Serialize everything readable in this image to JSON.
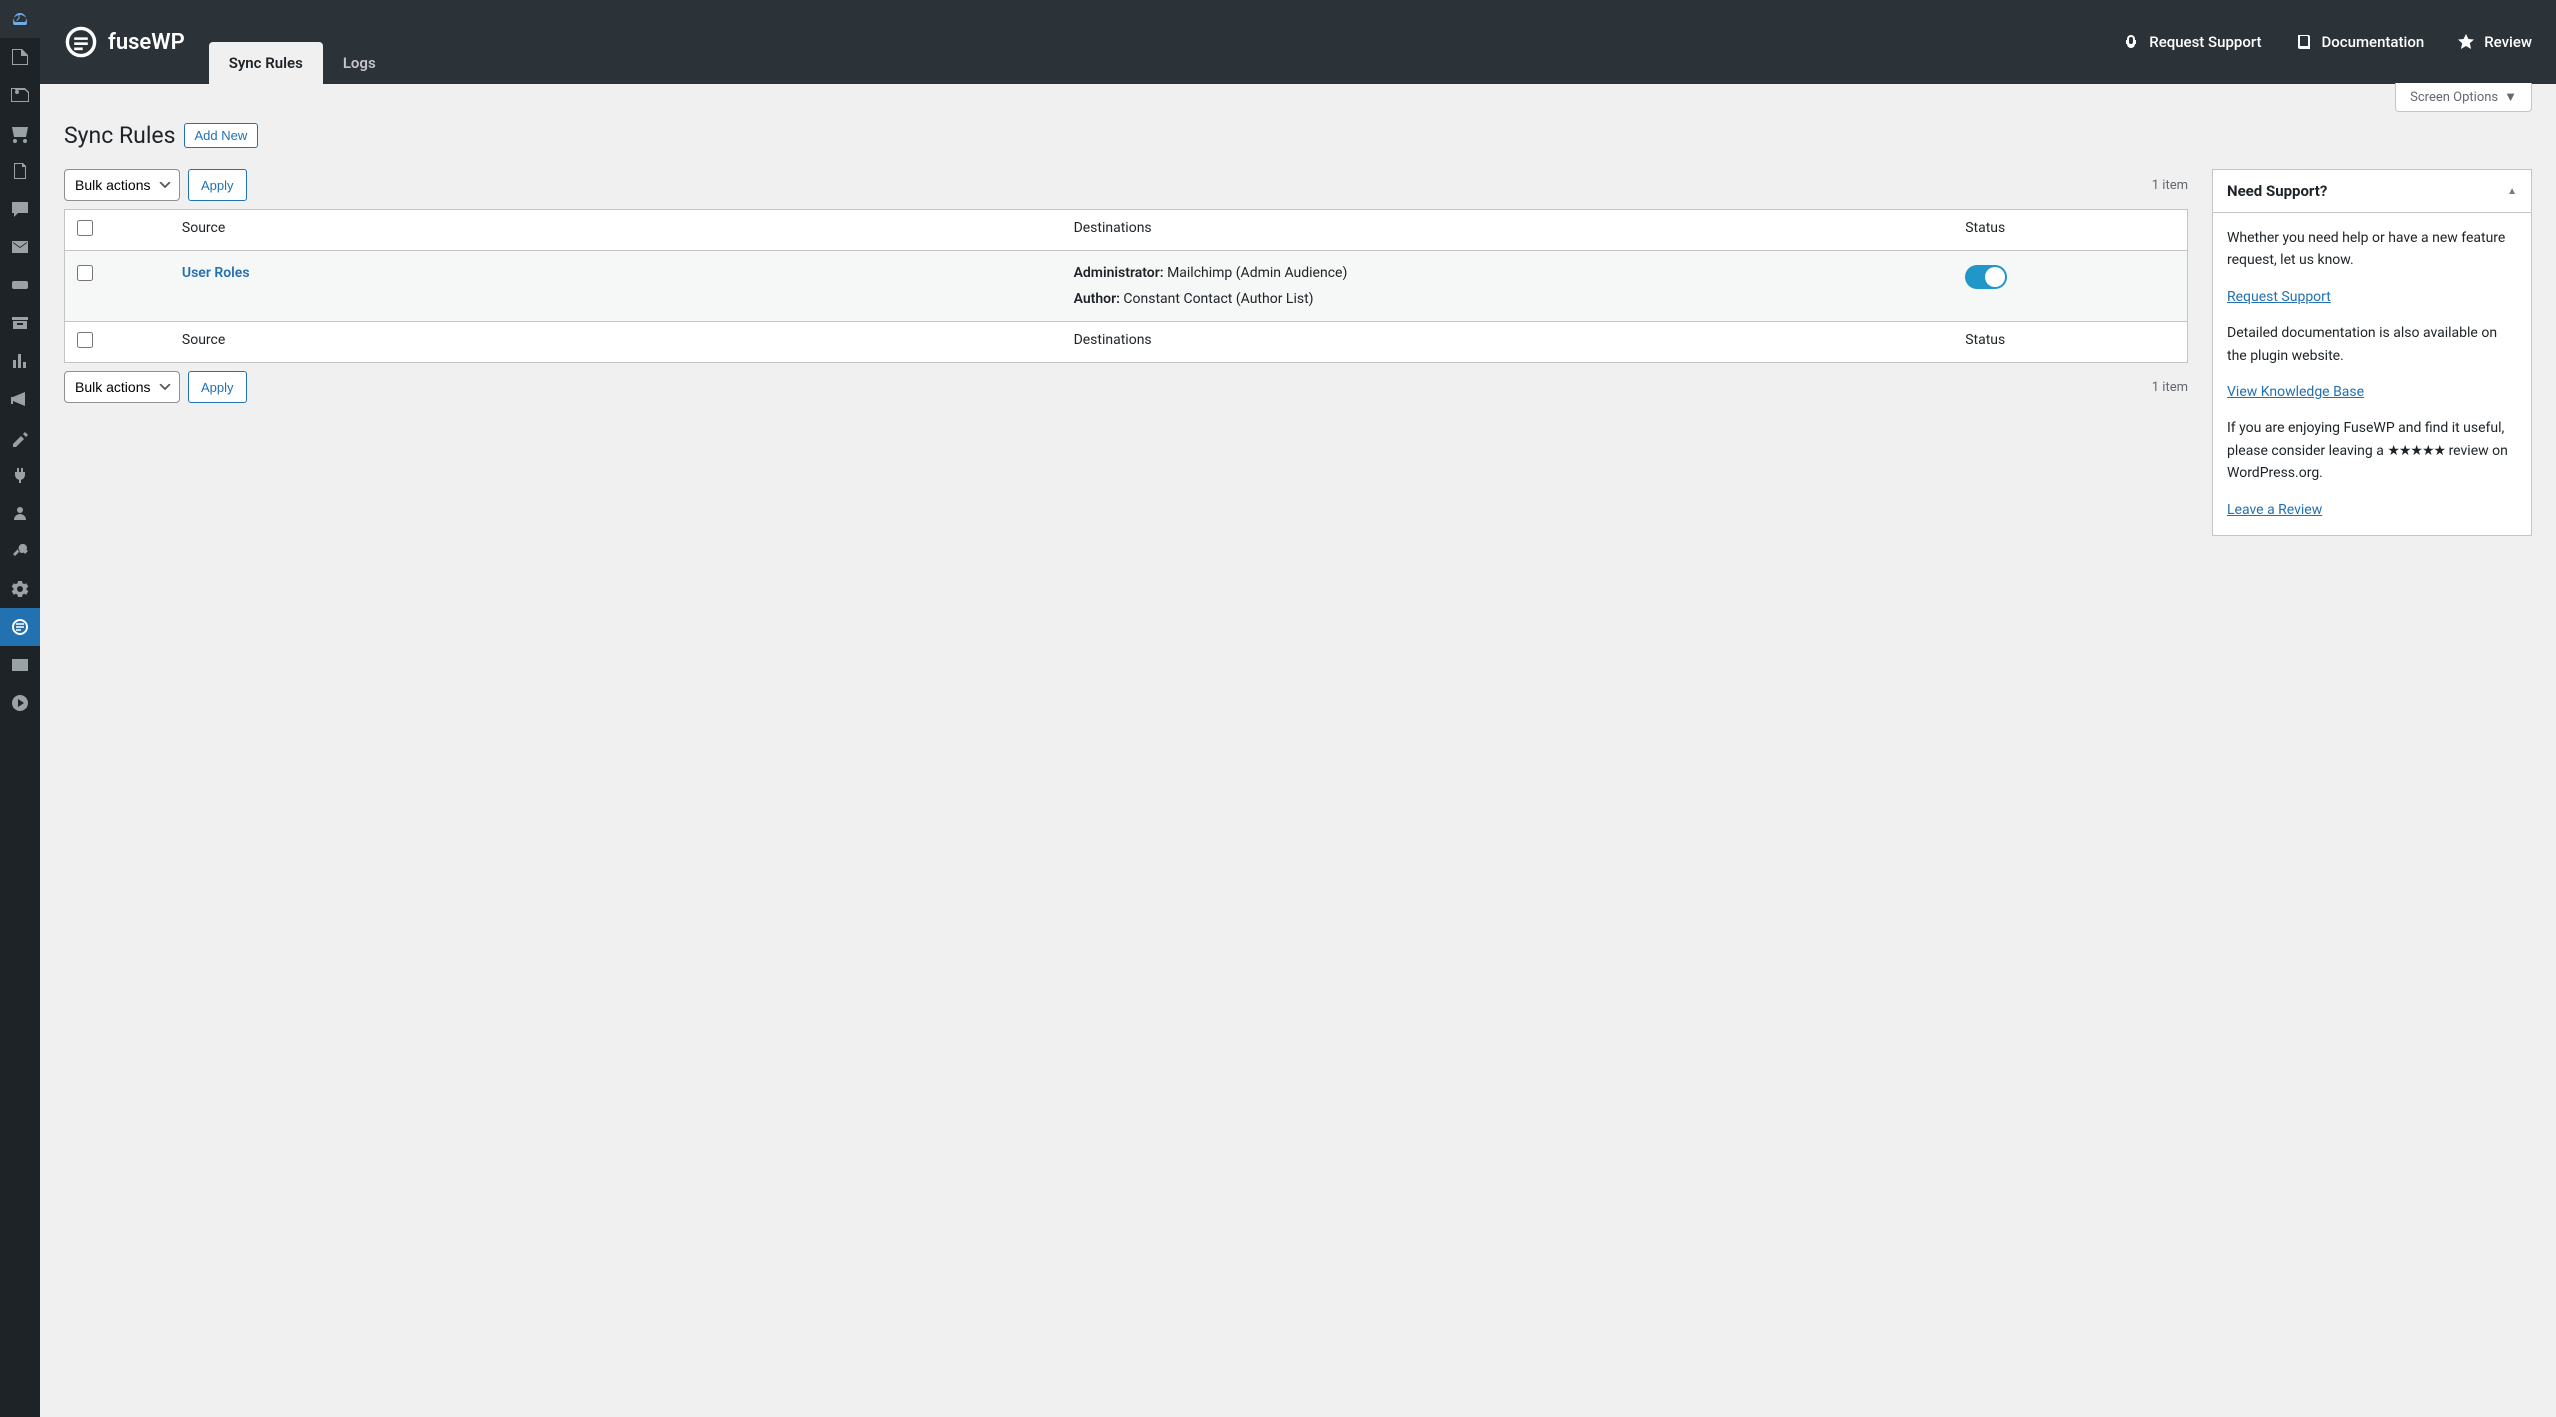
{
  "brand": "fuseWP",
  "header": {
    "tabs": [
      {
        "label": "Sync Rules",
        "active": true
      },
      {
        "label": "Logs",
        "active": false
      }
    ],
    "links": {
      "support": "Request Support",
      "docs": "Documentation",
      "review": "Review"
    }
  },
  "screen_options": "Screen Options",
  "page": {
    "title": "Sync Rules",
    "add_new": "Add New"
  },
  "bulk": {
    "label": "Bulk actions",
    "apply": "Apply"
  },
  "item_count": "1 item",
  "table": {
    "headers": {
      "source": "Source",
      "destinations": "Destinations",
      "status": "Status"
    },
    "rows": [
      {
        "source": "User Roles",
        "destinations": [
          {
            "label": "Administrator:",
            "value": "Mailchimp (Admin Audience)"
          },
          {
            "label": "Author:",
            "value": "Constant Contact (Author List)"
          }
        ],
        "status": true
      }
    ]
  },
  "support_box": {
    "title": "Need Support?",
    "p1": "Whether you need help or have a new feature request, let us know.",
    "link1": "Request Support",
    "p2": "Detailed documentation is also available on the plugin website.",
    "link2": "View Knowledge Base",
    "p3a": "If you are enjoying FuseWP and find it useful, please consider leaving a ",
    "stars": "★★★★★",
    "p3b": " review on WordPress.org.",
    "link3": "Leave a Review"
  }
}
